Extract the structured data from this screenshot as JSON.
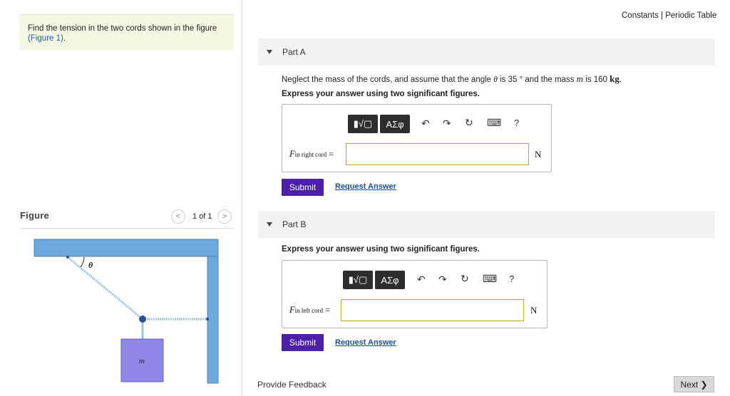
{
  "problem": {
    "text": "Find the tension in the two cords shown in the figure",
    "figure_link": "(Figure 1)",
    "suffix": "."
  },
  "figure": {
    "label": "Figure",
    "counter": "1 of 1",
    "angle_symbol": "θ",
    "mass_symbol": "m",
    "colors": {
      "beam": "#6fa8dc",
      "mass": "#8f87e6",
      "cord": "#9fc4e0",
      "knot": "#2e4e96"
    }
  },
  "header_links": {
    "constants": "Constants",
    "separator": "|",
    "periodic_table": "Periodic Table"
  },
  "partA": {
    "title": "Part A",
    "question_pre": "Neglect the mass of the cords, and assume that the angle",
    "theta": "θ",
    "question_mid": "is 35 °  and the mass",
    "m": "m",
    "question_post": "is 160",
    "unit_kg": "kg",
    "period": ".",
    "instruction": "Express your answer using two significant figures.",
    "label_var": "F",
    "label_sub": "in right cord",
    "label_eq": "=",
    "unit": "N",
    "submit": "Submit",
    "request": "Request Answer"
  },
  "partB": {
    "title": "Part B",
    "instruction": "Express your answer using two significant figures.",
    "label_var": "F",
    "label_sub": "in left cord",
    "label_eq": "=",
    "unit": "N",
    "submit": "Submit",
    "request": "Request Answer"
  },
  "toolbar": {
    "templates_label": "▮√▢",
    "symbols_label": "ΑΣφ",
    "undo_icon": "↶",
    "redo_icon": "↷",
    "reset_icon": "↻",
    "keyboard_icon": "⌨",
    "help": "?"
  },
  "footer": {
    "feedback": "Provide Feedback",
    "next": "Next ❯"
  }
}
